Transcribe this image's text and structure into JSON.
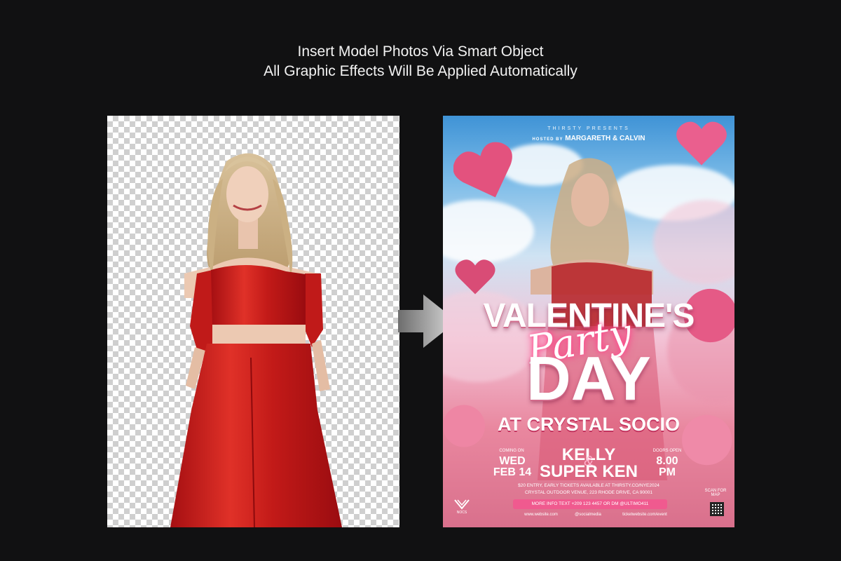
{
  "headline": {
    "line1": "Insert Model Photos Via Smart Object",
    "line2": "All Graphic Effects Will Be Applied Automatically"
  },
  "poster": {
    "presents": "THIRSTY PRESENTS",
    "hosted_by_label": "HOSTED BY",
    "hosted_by_names": "MARGARETH & CALVIN",
    "title_line1": "VALENTINE'S",
    "title_script": "Party",
    "title_line2": "DAY",
    "venue_title": "AT CRYSTAL SOCIO",
    "coming_on_label": "COMING ON",
    "date_day": "WED",
    "date_full": "FEB 14",
    "performer1": "KELLY",
    "performer_amp": "&",
    "performer2": "SUPER KEN",
    "doors_open_label": "DOORS OPEN",
    "doors_time": "8.00",
    "doors_ampm": "PM",
    "entry_line": "$20 ENTRY, EARLY TICKETS AVAILABLE AT THIRSTY.CO/NYE2024",
    "venue_line": "CRYSTAL OUTDOOR VENUE, 223 RHODE DRIVE, CA 90001",
    "more_info": "MORE INFO TEXT +209 123 4457 OR DM @ULTIMO411",
    "scan_label": "SCAN FOR MAP",
    "logo_text": "NOCS",
    "footer_website": "www.website.com",
    "footer_social": "@socialmedia",
    "footer_tickets": "ticketwebsite.com/event"
  },
  "colors": {
    "background": "#111112",
    "red_outfit": "#d6201e",
    "pink_accent": "#f05a8f",
    "sky_blue": "#4a9ad9"
  }
}
